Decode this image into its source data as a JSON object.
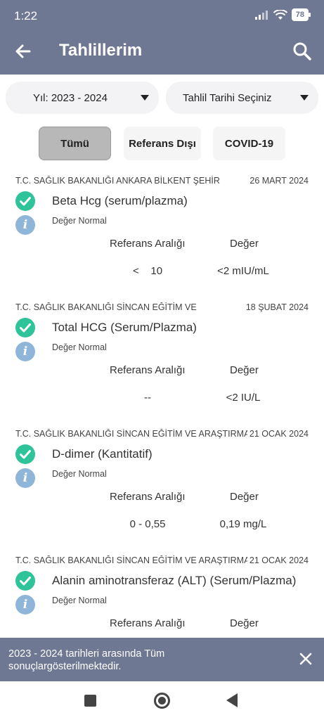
{
  "status_bar": {
    "time": "1:22",
    "battery": "78"
  },
  "app_bar": {
    "title": "Tahlillerim"
  },
  "filters": {
    "year_label": "Yıl: 2023 - 2024",
    "date_label": "Tahlil Tarihi Seçiniz"
  },
  "chips": [
    "Tümü",
    "Referans Dışı",
    "COVID-19"
  ],
  "column_headers": {
    "reference": "Referans Aralığı",
    "value": "Değer"
  },
  "results": [
    {
      "hospital": "T.C. SAĞLIK BAKANLIĞI ANKARA BİLKENT ŞEHİR",
      "date": "26 MART 2024",
      "test": "Beta Hcg (serum/plazma)",
      "status": "Değer Normal",
      "reference": "<    10",
      "value": "<2 mIU/mL"
    },
    {
      "hospital": "T.C. SAĞLIK BAKANLIĞI SİNCAN EĞİTİM VE",
      "date": "18 ŞUBAT 2024",
      "test": "Total HCG (Serum/Plazma)",
      "status": "Değer Normal",
      "reference": "--",
      "value": "<2 IU/L"
    },
    {
      "hospital": "T.C. SAĞLIK BAKANLIĞI SİNCAN EĞİTİM VE ARAŞTIRMA",
      "date": "21 OCAK 2024",
      "test": "D-dimer (Kantitatif)",
      "status": "Değer Normal",
      "reference": "0 - 0,55",
      "value": "0,19 mg/L"
    },
    {
      "hospital": "T.C. SAĞLIK BAKANLIĞI SİNCAN EĞİTİM VE ARAŞTIRMA",
      "date": "21 OCAK 2024",
      "test": "Alanin aminotransferaz (ALT) (Serum/Plazma)",
      "status": "Değer Normal",
      "reference": "",
      "value": ""
    }
  ],
  "snackbar": {
    "message": "2023 - 2024 tarihleri arasında Tüm sonuçlargösterilmektedir."
  },
  "icons": {
    "back": "arrow-left-icon",
    "search": "search-icon",
    "check": "check-circle-icon",
    "info": "info-icon",
    "close": "close-icon"
  },
  "colors": {
    "primary": "#6f7893",
    "check": "#2fc39a",
    "info": "#8fb6d9",
    "chip_active": "#b8b8b8"
  }
}
